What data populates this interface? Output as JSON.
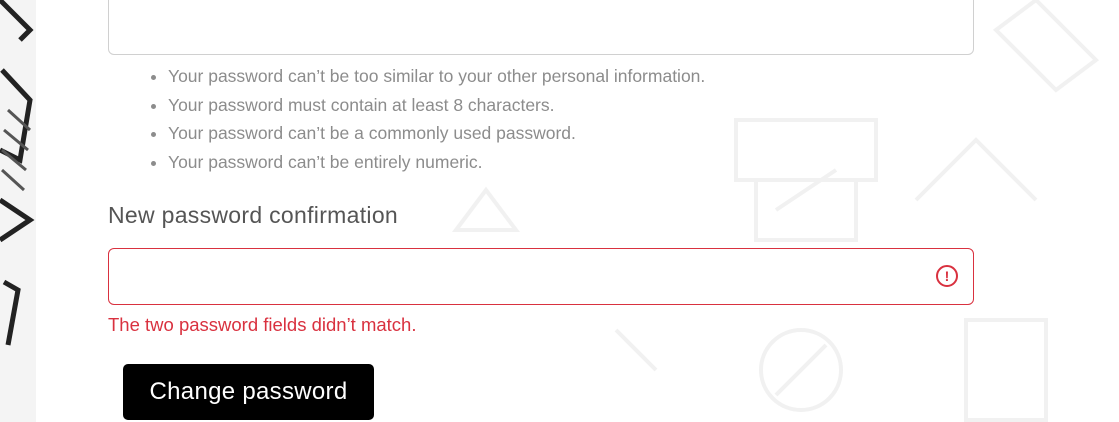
{
  "password_help": [
    "Your password can’t be too similar to your other personal information.",
    "Your password must contain at least 8 characters.",
    "Your password can’t be a commonly used password.",
    "Your password can’t be entirely numeric."
  ],
  "confirmation": {
    "label": "New password confirmation",
    "value": "",
    "error": "The two password fields didn’t match.",
    "error_icon_glyph": "!"
  },
  "submit_label": "Change password",
  "colors": {
    "error": "#d9313f",
    "help_text": "#8c8c8c",
    "button_bg": "#000000",
    "button_text": "#ffffff",
    "input_border": "#d0d0d0"
  }
}
